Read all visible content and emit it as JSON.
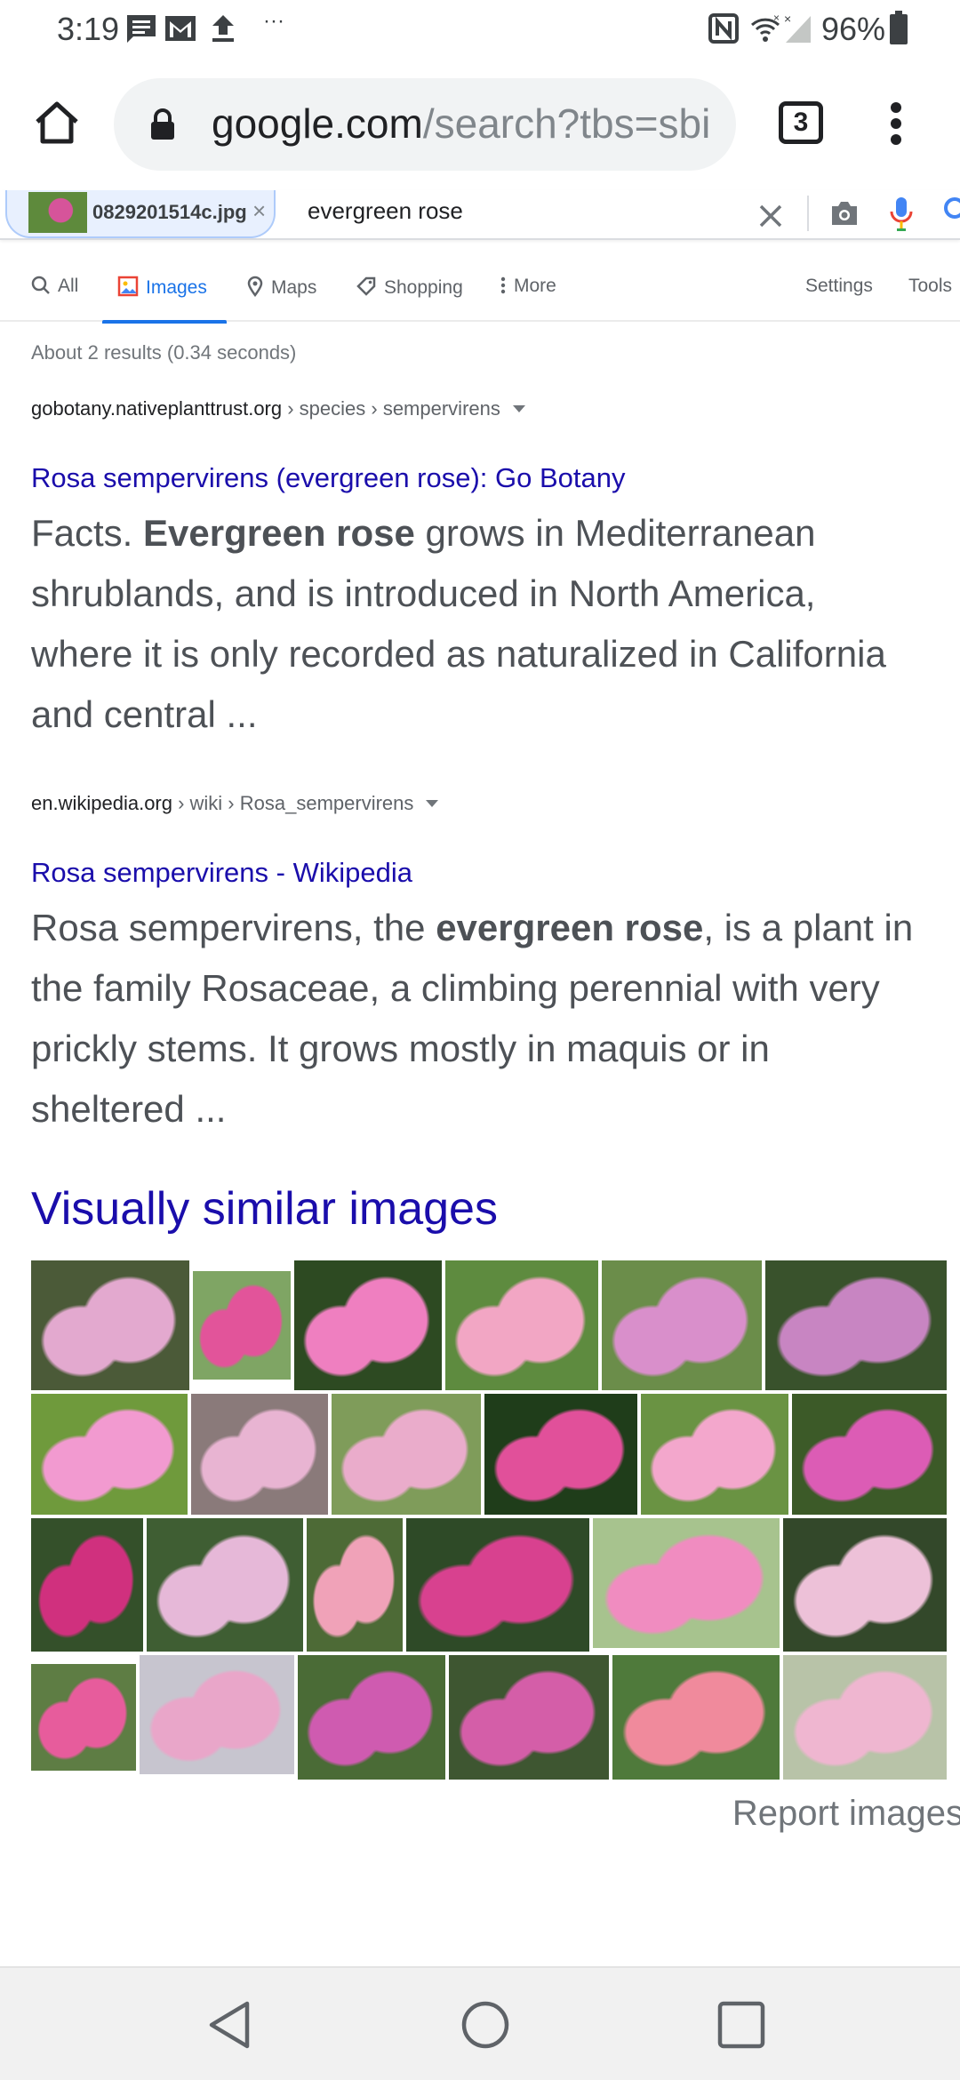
{
  "status_bar": {
    "time": "3:19",
    "battery": "96%",
    "more": "···"
  },
  "browser": {
    "url_domain": "google.com",
    "url_path": "/search?tbs=sbi",
    "tab_count": "3"
  },
  "search": {
    "image_chip_label": "0829201514c.jpg",
    "query": "evergreen rose"
  },
  "tabs": [
    {
      "label": "All",
      "icon": "search-icon"
    },
    {
      "label": "Images",
      "icon": "images-icon"
    },
    {
      "label": "Maps",
      "icon": "map-pin-icon"
    },
    {
      "label": "Shopping",
      "icon": "tag-icon"
    },
    {
      "label": "More",
      "icon": "dots-vertical-icon"
    },
    {
      "label": "Settings"
    },
    {
      "label": "Tools"
    }
  ],
  "results_count": "About 2 results (0.34 seconds)",
  "results": [
    {
      "domain": "gobotany.nativeplanttrust.org",
      "breadcrumb": " › species › sempervirens",
      "title": "Rosa sempervirens (evergreen rose): Go Botany",
      "snippet_before": "Facts. ",
      "snippet_bold": "Evergreen rose",
      "snippet_after": " grows in Mediterranean shrublands, and is introduced in North America, where it is only recorded as naturalized in California and central ..."
    },
    {
      "domain": "en.wikipedia.org",
      "breadcrumb": " › wiki › Rosa_sempervirens",
      "title": "Rosa sempervirens - Wikipedia",
      "snippet_before": "Rosa sempervirens, the ",
      "snippet_bold": "evergreen rose",
      "snippet_after": ", is a plant in the family Rosaceae, a climbing perennial with very prickly stems. It grows mostly in maquis or in sheltered ..."
    }
  ],
  "similar_images": {
    "title": "Visually similar images",
    "report_label": "Report images",
    "images": [
      {
        "bg": "#4b5a38",
        "flower": "#e3a9cf"
      },
      {
        "bg": "#7fa564",
        "flower": "#e2549a"
      },
      {
        "bg": "#2d4a22",
        "flower": "#ef7fc0"
      },
      {
        "bg": "#5e8b3f",
        "flower": "#f2a6c4"
      },
      {
        "bg": "#6b8d4a",
        "flower": "#d98fcb"
      },
      {
        "bg": "#39522c",
        "flower": "#c885c2"
      },
      {
        "bg": "#6f9a3c",
        "flower": "#f29ad0"
      },
      {
        "bg": "#8a7a7a",
        "flower": "#e8b4d2"
      },
      {
        "bg": "#7f9c5a",
        "flower": "#eaaccb"
      },
      {
        "bg": "#1f3d1a",
        "flower": "#e1509a"
      },
      {
        "bg": "#6a9343",
        "flower": "#f3a7cc"
      },
      {
        "bg": "#3c5a28",
        "flower": "#dc5cb5"
      },
      {
        "bg": "#34502a",
        "flower": "#d0307e"
      },
      {
        "bg": "#3f5e33",
        "flower": "#e6b8d8"
      },
      {
        "bg": "#4d6a36",
        "flower": "#f0a2b8"
      },
      {
        "bg": "#2e4a27",
        "flower": "#d8418f"
      },
      {
        "bg": "#a7c38e",
        "flower": "#f08cc0"
      },
      {
        "bg": "#33482a",
        "flower": "#edc1d8"
      },
      {
        "bg": "#5e7d44",
        "flower": "#e75c9c"
      },
      {
        "bg": "#c7c5cf",
        "flower": "#e9a6c9"
      },
      {
        "bg": "#4a6b36",
        "flower": "#cf5bb0"
      },
      {
        "bg": "#3e5631",
        "flower": "#d45ea8"
      },
      {
        "bg": "#4f7a3b",
        "flower": "#f08a9c"
      },
      {
        "bg": "#b8c3a8",
        "flower": "#efb6d0"
      }
    ]
  }
}
